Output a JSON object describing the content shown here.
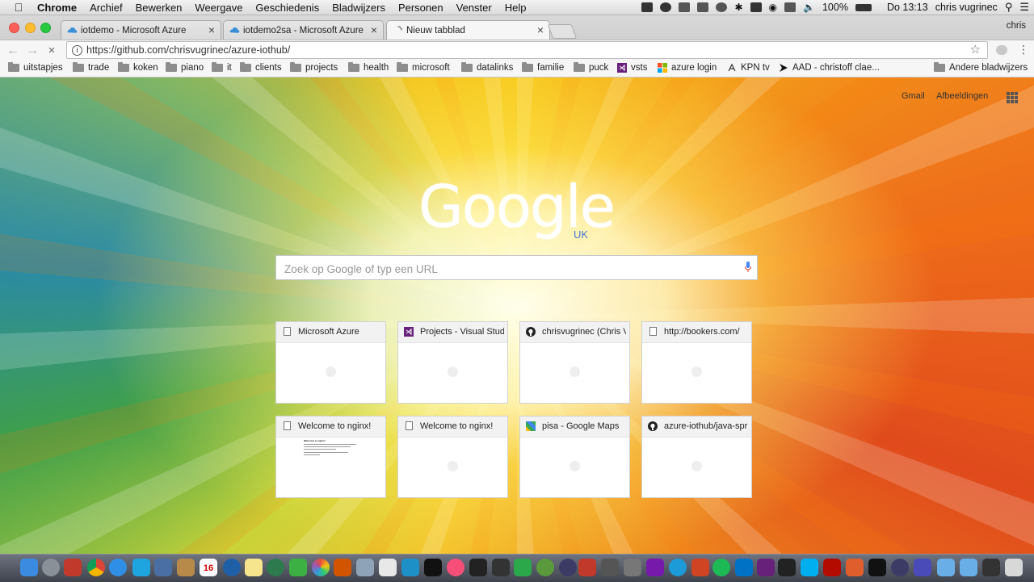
{
  "menubar": {
    "apple": "",
    "items": [
      "Chrome",
      "Archief",
      "Bewerken",
      "Weergave",
      "Geschiedenis",
      "Bladwijzers",
      "Personen",
      "Venster",
      "Help"
    ],
    "battery": "100%",
    "clock": "Do 13:13",
    "user": "chris vugrinec"
  },
  "tabs": [
    {
      "title": "iotdemo - Microsoft Azure",
      "close": "×",
      "active": false
    },
    {
      "title": "iotdemo2sa - Microsoft Azure",
      "close": "×",
      "active": false
    },
    {
      "title": "Nieuw tabblad",
      "close": "×",
      "active": true
    }
  ],
  "profile_name": "chris",
  "toolbar": {
    "back": "←",
    "forward": "→",
    "url": "https://github.com/chrisvugrinec/azure-iothub/",
    "star": "☆",
    "menu": "⋮"
  },
  "bookmarks": [
    {
      "label": "uitstapjes",
      "icon": "folder"
    },
    {
      "label": "trade",
      "icon": "folder"
    },
    {
      "label": "koken",
      "icon": "folder"
    },
    {
      "label": "piano",
      "icon": "folder"
    },
    {
      "label": "it",
      "icon": "folder"
    },
    {
      "label": "clients",
      "icon": "folder"
    },
    {
      "label": "projects",
      "icon": "folder"
    },
    {
      "label": "health",
      "icon": "folder"
    },
    {
      "label": "microsoft",
      "icon": "folder"
    },
    {
      "label": "datalinks",
      "icon": "folder"
    },
    {
      "label": "familie",
      "icon": "folder"
    },
    {
      "label": "puck",
      "icon": "folder"
    },
    {
      "label": "vsts",
      "icon": "visual-studio"
    },
    {
      "label": "azure login",
      "icon": "microsoft"
    },
    {
      "label": "KPN tv",
      "icon": "kpn"
    },
    {
      "label": "AAD - christoff clae...",
      "icon": "arrow"
    },
    {
      "label": "Andere bladwijzers",
      "icon": "folder"
    }
  ],
  "ntp": {
    "gmail": "Gmail",
    "images": "Afbeeldingen",
    "logo": "Google",
    "region": "UK",
    "search_placeholder": "Zoek op Google of typ een URL"
  },
  "tiles": [
    {
      "title": "Microsoft Azure",
      "icon": "document-icon"
    },
    {
      "title": "Projects - Visual Studio",
      "icon": "visual-studio-icon"
    },
    {
      "title": "chrisvugrinec (Chris Vugrinec)",
      "icon": "github-icon"
    },
    {
      "title": "http://bookers.com/",
      "icon": "document-icon"
    },
    {
      "title": "Welcome to nginx!",
      "icon": "document-icon"
    },
    {
      "title": "Welcome to nginx!",
      "icon": "document-icon"
    },
    {
      "title": "pisa - Google Maps",
      "icon": "google-maps-icon"
    },
    {
      "title": "azure-iothub/java-spring",
      "icon": "github-icon"
    }
  ],
  "tile_thumb": {
    "heading": "Welcome to nginx!"
  },
  "dock_date": "16",
  "colors": {
    "accent_blue": "#4a78d4",
    "traffic_red": "#fc5f57",
    "traffic_yellow": "#fdbc2e",
    "traffic_green": "#28c840"
  }
}
